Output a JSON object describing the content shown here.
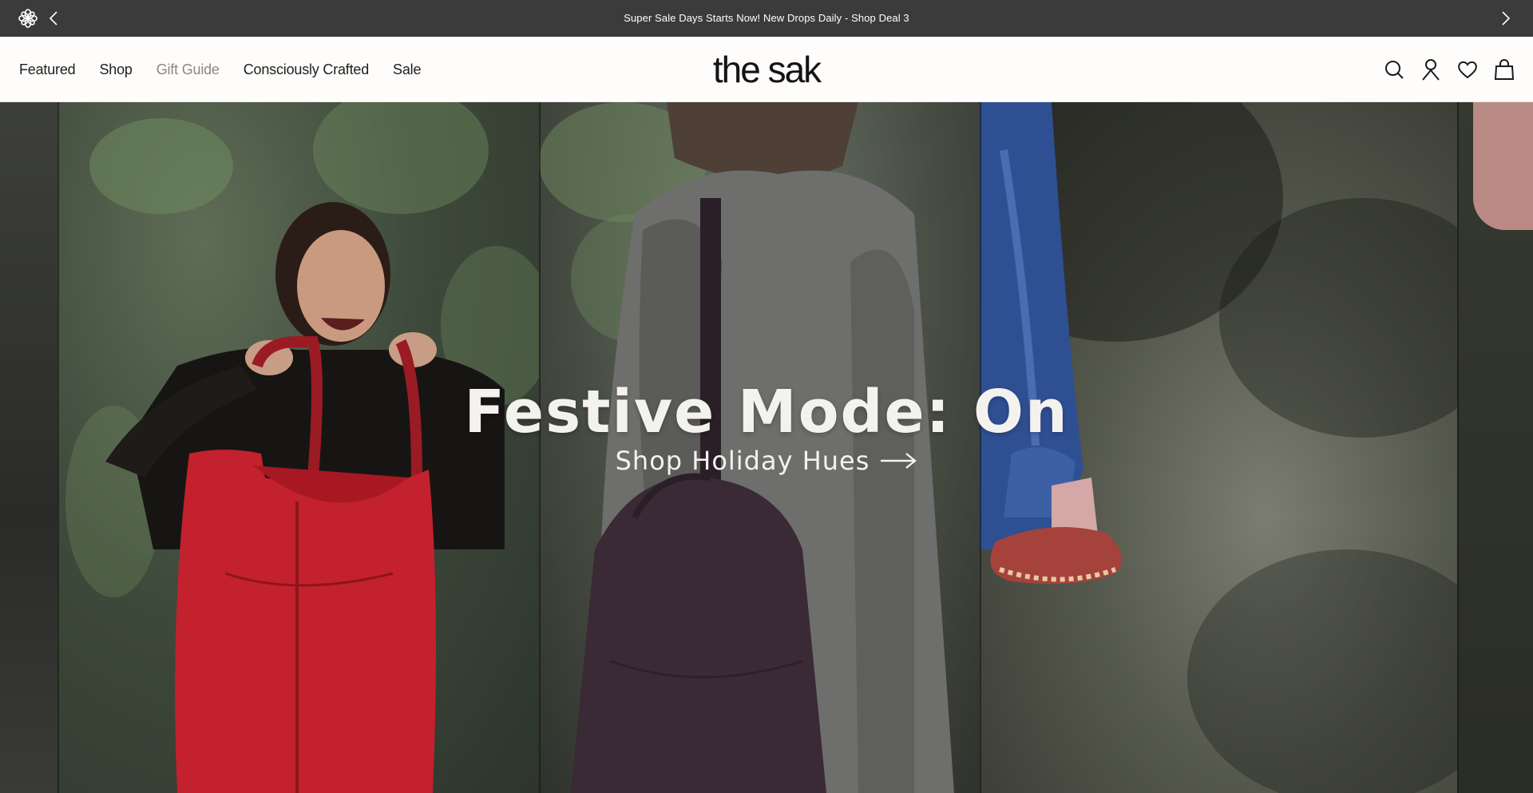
{
  "announcement": {
    "message": "Super Sale Days Starts Now! New Drops Daily - Shop Deal 3"
  },
  "nav": {
    "items": [
      {
        "label": "Featured"
      },
      {
        "label": "Shop"
      },
      {
        "label": "Gift Guide"
      },
      {
        "label": "Consciously Crafted"
      },
      {
        "label": "Sale"
      }
    ]
  },
  "brand": {
    "logo_text": "the sak"
  },
  "header_icons": [
    "search-icon",
    "account-icon",
    "wishlist-icon",
    "cart-icon"
  ],
  "hero": {
    "headline": "Festive Mode: On",
    "cta_label": "Shop Holiday Hues",
    "image_description_icons": [
      "arrow-right-icon"
    ]
  },
  "colors": {
    "announcement_bg": "#3b3b3b",
    "header_bg": "#fffdfb",
    "muted_nav": "#8a8783",
    "hero_text": "#f4f2ee",
    "tote_red": "#c3212d",
    "tote_plum": "#3a2a35"
  }
}
